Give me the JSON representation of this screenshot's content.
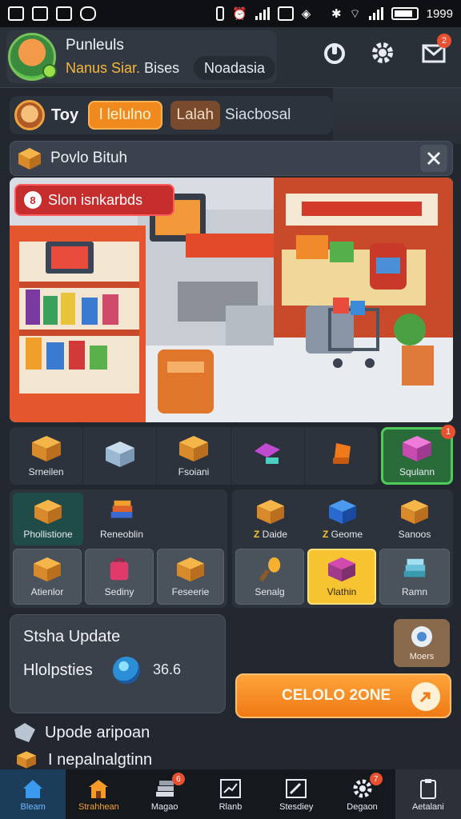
{
  "status_bar": {
    "time": "1999"
  },
  "header": {
    "player_name": "Punleuls",
    "player_rank": "Nanus Siar.",
    "player_sub": "Bises",
    "region": "Noadasia",
    "mail_count": "2"
  },
  "currency": {
    "label": "Toy",
    "orange_pill": "l lelulno",
    "brown_pill": "Lalah",
    "text": "Siacbosal"
  },
  "mission": {
    "title": "Povlo Bituh"
  },
  "scene": {
    "banner": "Slon isnkarbds",
    "banner_badge": "8"
  },
  "tools": [
    {
      "label": "Srneilen",
      "icon": "box-icon"
    },
    {
      "label": "",
      "icon": "crate-icon"
    },
    {
      "label": "Fsoiani",
      "icon": "box-icon"
    },
    {
      "label": "",
      "icon": "scanner-icon"
    },
    {
      "label": "",
      "icon": "tape-icon"
    }
  ],
  "tool_special": {
    "label": "Squlann",
    "count": "1"
  },
  "grid_left": [
    {
      "label": "Phollistione",
      "icon": "box-icon"
    },
    {
      "label": "Reneoblin",
      "icon": "books-icon"
    },
    {
      "label": "Atienlor",
      "icon": "box-icon"
    },
    {
      "label": "Sediny",
      "icon": "bag-icon"
    },
    {
      "label": "Feseerie",
      "icon": "box-icon"
    }
  ],
  "grid_right": [
    {
      "label": "Daide",
      "prefix": "Z",
      "icon": "box-icon"
    },
    {
      "label": "Geome",
      "prefix": "Z",
      "icon": "cube-icon"
    },
    {
      "label": "Sanoos",
      "prefix": "",
      "icon": "box-icon"
    },
    {
      "label": "Senalg",
      "icon": "torch-icon"
    },
    {
      "label": "Vlathin",
      "icon": "robot-icon"
    },
    {
      "label": "Ramn",
      "icon": "stack-icon"
    }
  ],
  "stats": {
    "title": "Stsha Update",
    "label": "Hlolpsties",
    "value": "36.6"
  },
  "mini_button": {
    "label": "Moers"
  },
  "cta": {
    "label": "CELOLO 2ONE"
  },
  "updates": [
    {
      "text": "Upode aripoan"
    },
    {
      "text": "I nepalnalgtinn"
    }
  ],
  "bottom_nav": [
    {
      "label": "Bleam",
      "icon": "home-icon"
    },
    {
      "label": "Strahhean",
      "icon": "shop-icon"
    },
    {
      "label": "Magao",
      "icon": "stack-icon",
      "badge": "6"
    },
    {
      "label": "Rlanb",
      "icon": "chart-icon"
    },
    {
      "label": "Stesdiey",
      "icon": "edit-icon"
    },
    {
      "label": "Degaon",
      "icon": "gear-icon",
      "badge": "7"
    },
    {
      "label": "Aetalani",
      "icon": "clipboard-icon"
    }
  ],
  "colors": {
    "accent_orange": "#f08a1f",
    "accent_yellow": "#f6c431",
    "accent_green": "#4ecb5a",
    "accent_red": "#c62d2d",
    "panel": "#2d333c",
    "background": "#232830"
  }
}
